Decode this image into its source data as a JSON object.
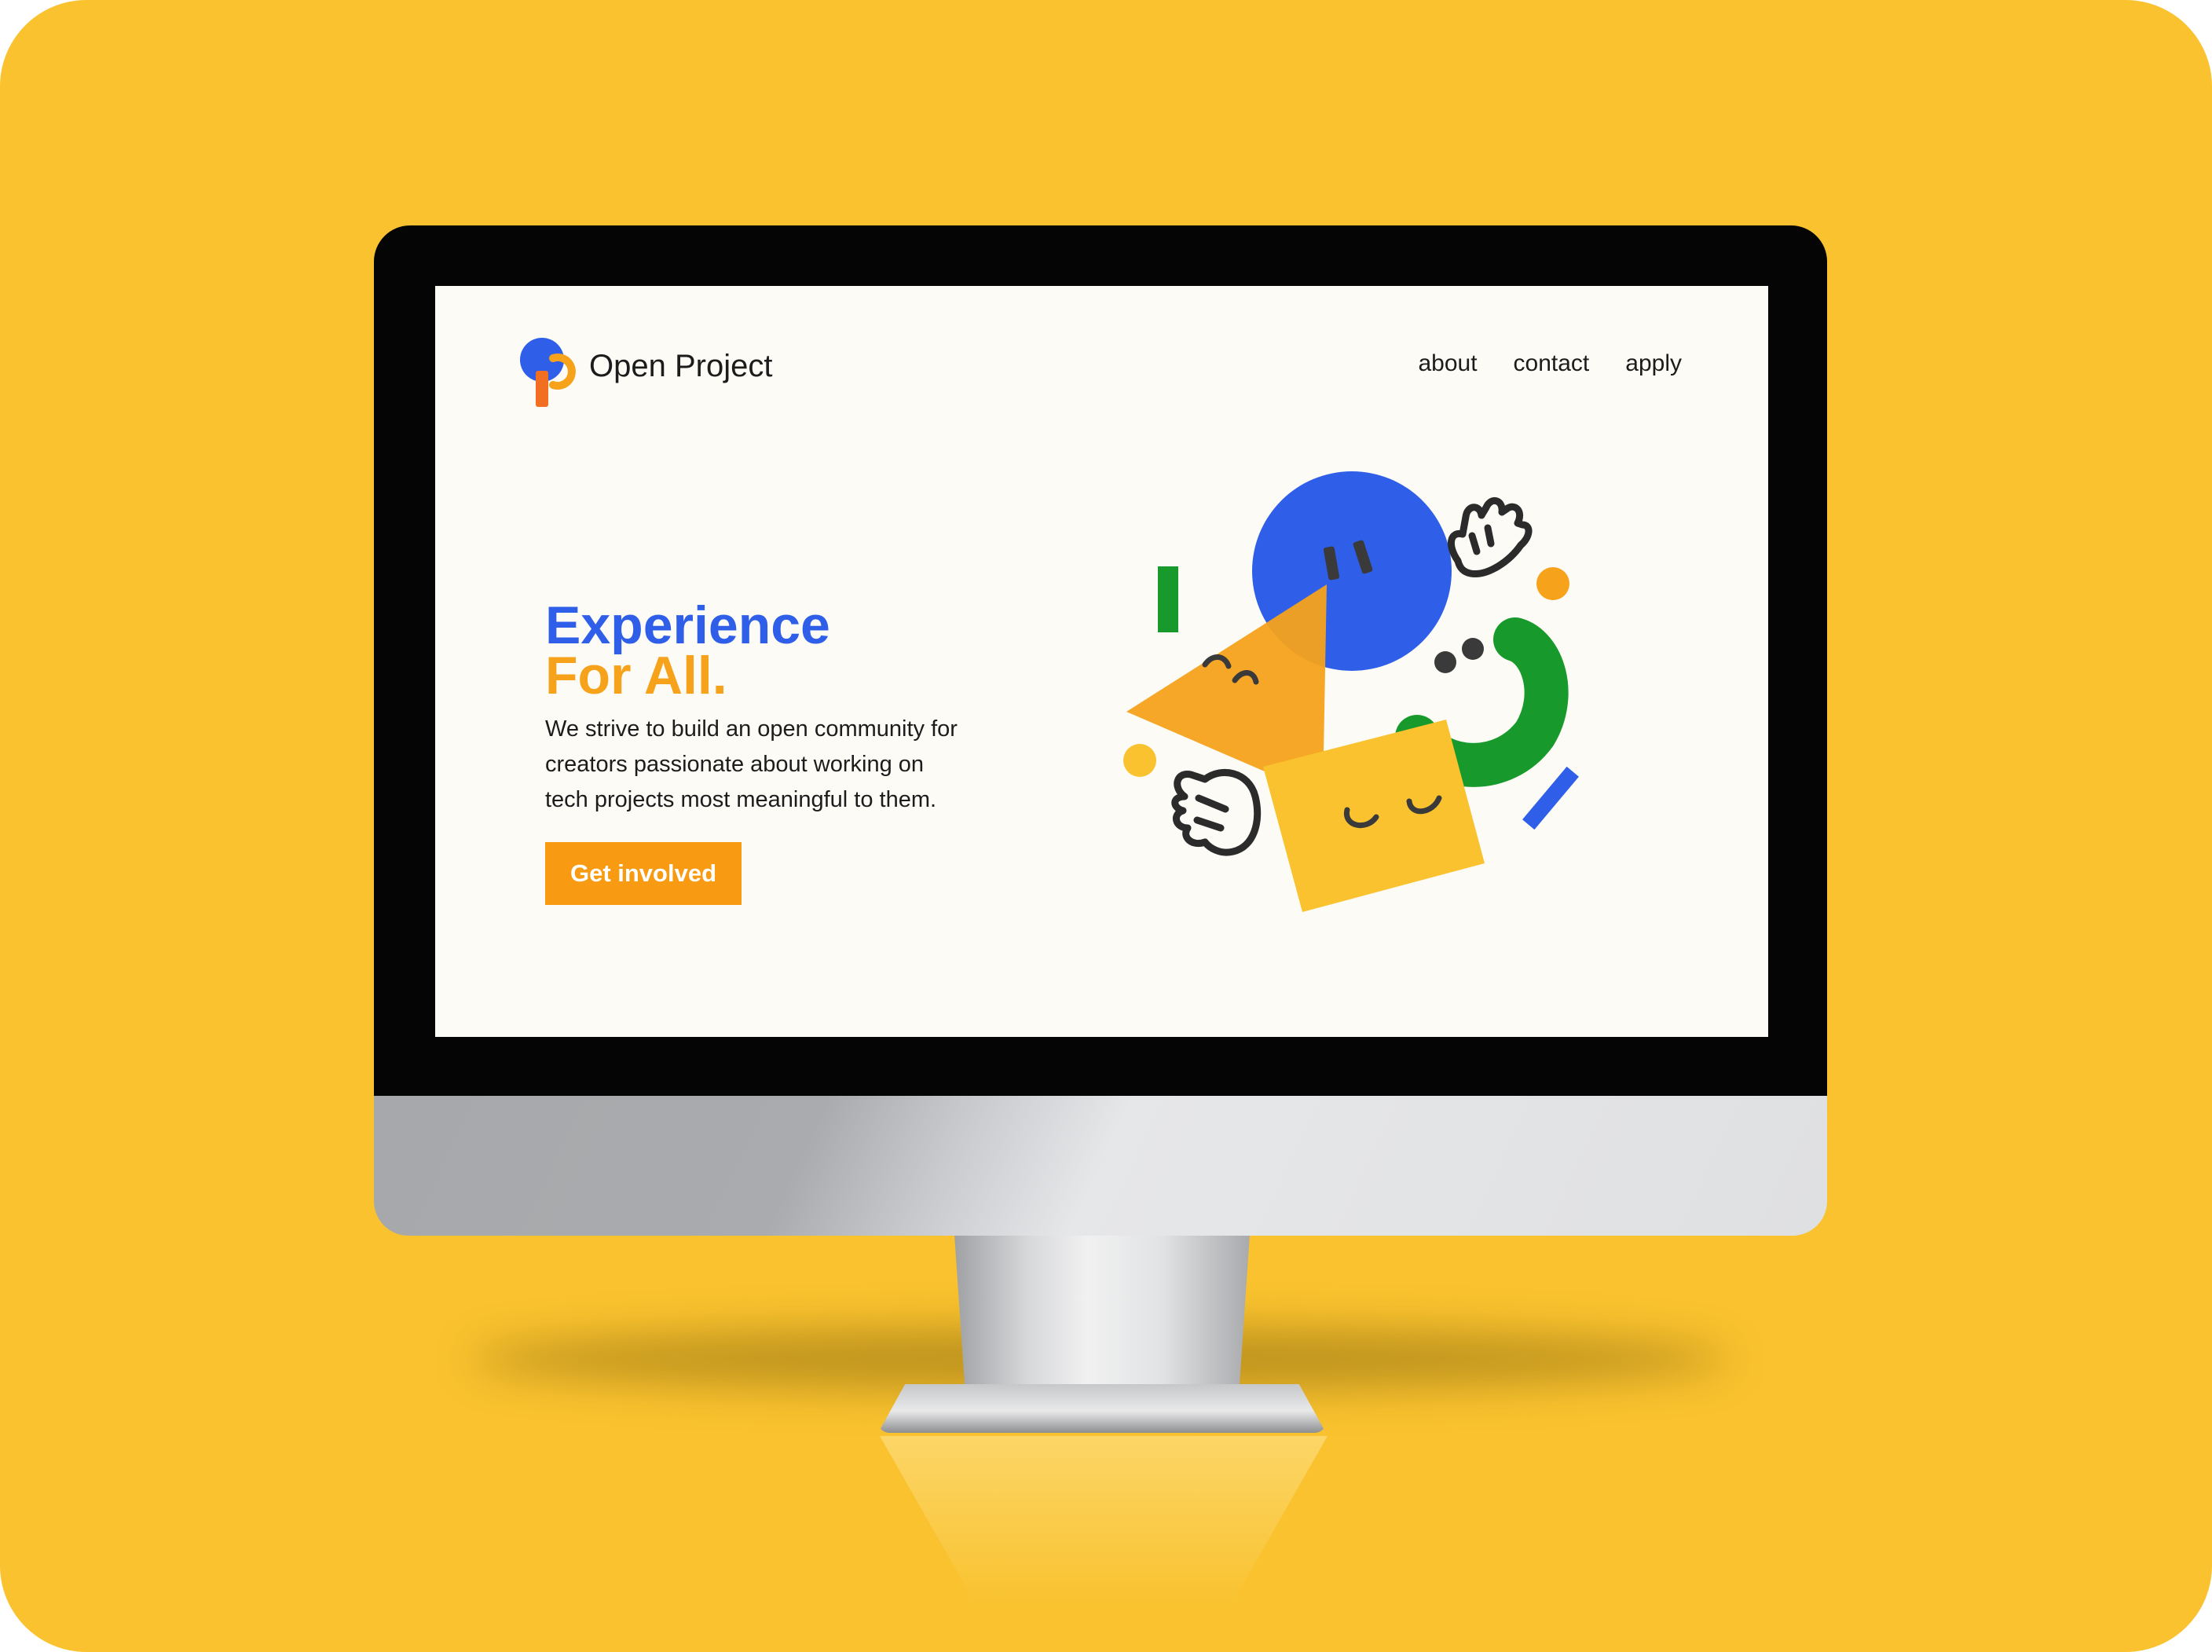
{
  "site": {
    "brand_name": "Open Project",
    "nav": [
      "about",
      "contact",
      "apply"
    ]
  },
  "hero": {
    "headline_line1": "Experience",
    "headline_line2": "For All.",
    "body_lines": [
      "We strive to build an open community for",
      "creators passionate about working on",
      "tech projects most meaningful to them."
    ],
    "cta_label": "Get involved"
  },
  "colors": {
    "page_background": "#f9c22e",
    "screen_background": "#fcfbf6",
    "brand_blue": "#2f5fe8",
    "brand_orange": "#f7a21b",
    "brand_green": "#179a2b",
    "brand_yellow": "#f9c22e",
    "text": "#1c1c1c"
  },
  "icons": {
    "logo": "open-project-logo",
    "illustration": [
      "blue-circle-face",
      "triangle-face",
      "square-face",
      "green-arc-face",
      "waving-hand-top",
      "waving-hand-bottom",
      "confetti-shapes"
    ]
  }
}
